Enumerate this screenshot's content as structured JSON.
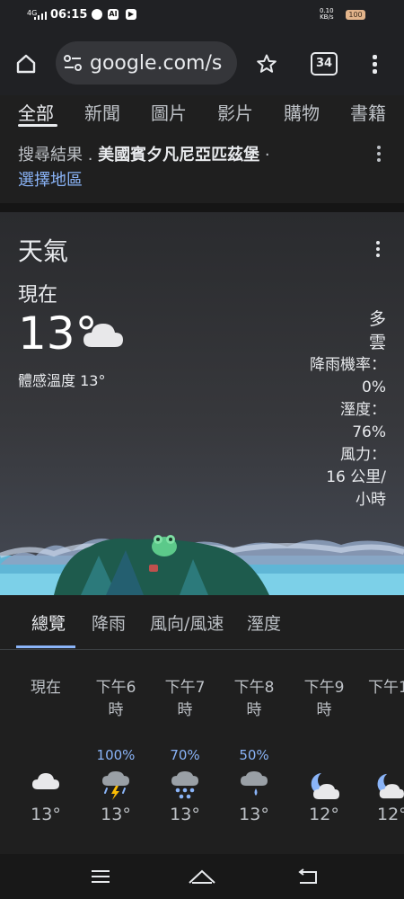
{
  "status_bar": {
    "network": "4G",
    "time": "06:15",
    "ai_label": "AI",
    "speed_value": "0.10",
    "speed_unit": "KB/s",
    "battery": "100"
  },
  "browser": {
    "url": "google.com/s",
    "tab_count": "34"
  },
  "filters": {
    "tabs": [
      "全部",
      "新聞",
      "圖片",
      "影片",
      "購物",
      "書籍"
    ],
    "active_index": 0
  },
  "location": {
    "prefix": "搜尋結果 . ",
    "place": "美國賓夕凡尼亞匹茲堡",
    "suffix": " ·",
    "change_link": "選擇地區"
  },
  "weather": {
    "title": "天氣",
    "now_label": "現在",
    "temperature": "13°",
    "feels_like": "體感溫度 13°",
    "condition": "多雲",
    "precip_label": "降雨機率：",
    "precip_value": "0%",
    "humidity_label": "溼度：",
    "humidity_value": "76%",
    "wind_label": "風力：",
    "wind_value": "16 公里/小時",
    "condition_icon": "cloud-icon"
  },
  "hourly_tabs": {
    "tabs": [
      "總覽",
      "降雨",
      "風向/風速",
      "溼度"
    ],
    "active_index": 0
  },
  "hourly": [
    {
      "label": "現在",
      "precip": "",
      "icon": "cloud-icon",
      "temp": "13°"
    },
    {
      "label": "下午6時",
      "precip": "100%",
      "icon": "thunderstorm-icon",
      "temp": "13°"
    },
    {
      "label": "下午7時",
      "precip": "70%",
      "icon": "heavy-rain-icon",
      "temp": "13°"
    },
    {
      "label": "下午8時",
      "precip": "50%",
      "icon": "rain-icon",
      "temp": "13°"
    },
    {
      "label": "下午9時",
      "precip": "",
      "icon": "partly-cloudy-night-icon",
      "temp": "12°"
    },
    {
      "label": "下午1",
      "precip": "",
      "icon": "partly-cloudy-night-icon",
      "temp": "12°"
    }
  ],
  "colors": {
    "link": "#8ab4f8",
    "background": "#1f1f1f",
    "lightning": "#fbbc04",
    "rain": "#8ab4f8"
  }
}
